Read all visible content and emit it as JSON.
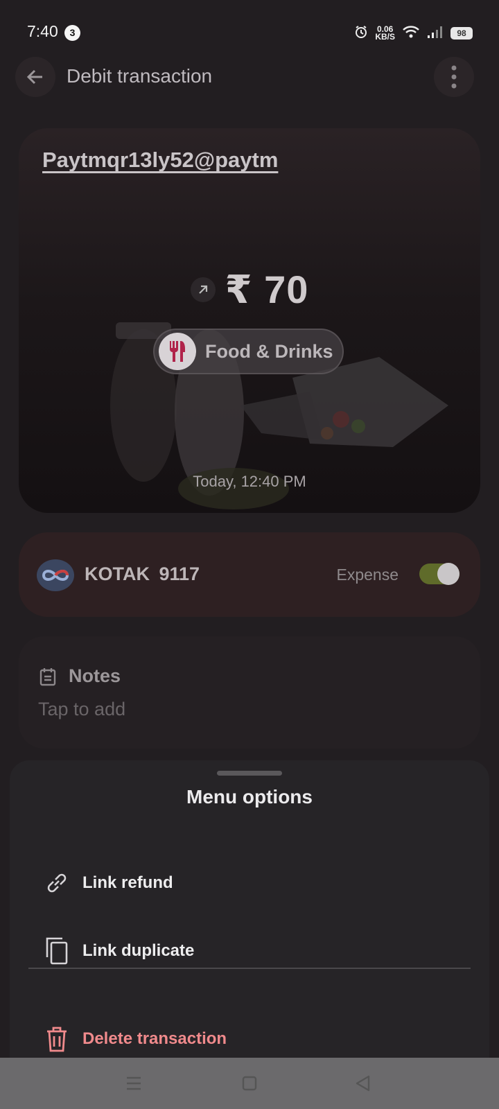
{
  "status_bar": {
    "time": "7:40",
    "notification_count": "3",
    "net_speed_value": "0.06",
    "net_speed_unit": "KB/S",
    "battery": "98"
  },
  "appbar": {
    "title": "Debit transaction"
  },
  "transaction": {
    "payee": "Paytmqr13ly52@paytm",
    "amount": "₹ 70",
    "category": "Food & Drinks",
    "datetime": "Today, 12:40 PM"
  },
  "account": {
    "bank": "KOTAK  9117",
    "type_label": "Expense",
    "expense_toggle_on": true
  },
  "notes": {
    "title": "Notes",
    "placeholder": "Tap to add"
  },
  "menu": {
    "title": "Menu options",
    "items": [
      {
        "label": "Link refund",
        "icon": "link-icon"
      },
      {
        "label": "Link duplicate",
        "icon": "copy-icon"
      },
      {
        "label": "Delete transaction",
        "icon": "trash-icon"
      }
    ]
  },
  "colors": {
    "danger": "#f08a8c",
    "accent_category": "#b0234a",
    "sheet_bg": "#262427"
  }
}
